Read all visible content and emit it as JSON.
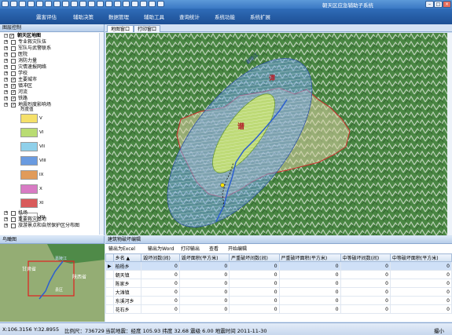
{
  "window": {
    "title": "朝天区应急辅助子系统",
    "minimize": "–",
    "maximize": "□",
    "close": "×"
  },
  "menu": [
    "震害评估",
    "辅助决策",
    "数据管理",
    "辅助工具",
    "查询统计",
    "系统功能",
    "系统扩展"
  ],
  "left_panel": {
    "title": "图层控制",
    "root": "朝天区地图",
    "layers_top": [
      {
        "label": "专业救灾队伍",
        "checked": false
      },
      {
        "label": "军队与武警联系",
        "checked": false
      },
      {
        "label": "医院",
        "checked": false
      },
      {
        "label": "消防力量",
        "checked": false
      },
      {
        "label": "灾情速报网络",
        "checked": false
      },
      {
        "label": "学校",
        "checked": false
      },
      {
        "label": "主要城市",
        "checked": true
      },
      {
        "label": "镇冲区",
        "checked": true
      },
      {
        "label": "河流",
        "checked": true
      },
      {
        "label": "铁路",
        "checked": true
      },
      {
        "label": "地震烈度影响场",
        "checked": true
      }
    ],
    "intensity_title": "烈度值",
    "intensity": [
      {
        "label": "V",
        "color": "#f5e06a"
      },
      {
        "label": "VI",
        "color": "#b9dc73"
      },
      {
        "label": "VII",
        "color": "#8fd0ea"
      },
      {
        "label": "VIII",
        "color": "#6a9be0"
      },
      {
        "label": "IX",
        "color": "#e19b5a"
      },
      {
        "label": "X",
        "color": "#d87bc4"
      },
      {
        "label": "XI",
        "color": "#d95a5a"
      },
      {
        "label": "XII",
        "color": "#ffffff"
      }
    ],
    "layers_bottom": [
      {
        "label": "机场",
        "checked": false
      },
      {
        "label": "重要救灾基地",
        "checked": false
      },
      {
        "label": "旅游景点和自然保护区分布图",
        "checked": false
      }
    ]
  },
  "map_tabs": [
    "地图窗口",
    "打印窗口"
  ],
  "map_labels": {
    "river": "嘉陵江",
    "town_mark": "谭",
    "center_mark": "谱"
  },
  "overview": {
    "title": "鸟瞰图",
    "labels": [
      "甘肃省",
      "陕西省",
      "嘉陵江",
      "县区"
    ]
  },
  "grid": {
    "title": "建筑物破坏编辑",
    "buttons": [
      "输出为Excel",
      "输出为Word",
      "打印输出",
      "查看",
      "开始编辑"
    ],
    "columns": [
      "乡名 ▲",
      "毁坏间数(间)",
      "毁坏面积(平方米)",
      "严重破坏间数(间)",
      "严重破坏面积(平方米)",
      "中等破坏间数(间)",
      "中等破坏面积(平方米)"
    ],
    "rows": [
      {
        "name": "柏杨乡",
        "vals": [
          "0",
          "0",
          "0",
          "0",
          "0",
          "0"
        ],
        "selected": true
      },
      {
        "name": "朝天镇",
        "vals": [
          "0",
          "0",
          "0",
          "0",
          "0",
          "0"
        ],
        "selected": false
      },
      {
        "name": "陈家乡",
        "vals": [
          "0",
          "0",
          "0",
          "0",
          "0",
          "0"
        ],
        "selected": false
      },
      {
        "name": "大滩镇",
        "vals": [
          "0",
          "0",
          "0",
          "0",
          "0",
          "0"
        ],
        "selected": false
      },
      {
        "name": "东溪河乡",
        "vals": [
          "0",
          "0",
          "0",
          "0",
          "0",
          "0"
        ],
        "selected": false
      },
      {
        "name": "花石乡",
        "vals": [
          "0",
          "0",
          "0",
          "0",
          "0",
          "0"
        ],
        "selected": false
      }
    ]
  },
  "status": {
    "x": "X:106.3156",
    "y": "Y:32.8955",
    "scale": "比例尺：736729",
    "quake": "当前地震：经度 105.93 纬度 32.68 震级 6.00 地震时间 2011-11-30",
    "right": "撮小"
  }
}
